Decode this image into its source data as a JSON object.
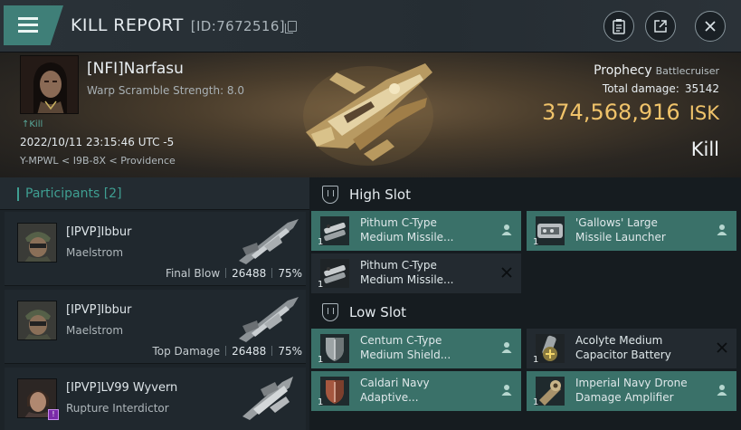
{
  "header": {
    "title": "KILL REPORT",
    "id_label": "[ID:7672516]"
  },
  "victim": {
    "name": "[NFI]Narfasu",
    "warp_scramble": "Warp Scramble Strength: 8.0",
    "kill_tag": "↑Kill",
    "timestamp": "2022/10/11 23:15:46 UTC -5",
    "location": "Y-MPWL < I9B-8X < Providence",
    "ship": "Prophecy",
    "ship_class": "Battlecruiser",
    "total_damage_label": "Total damage:",
    "total_damage": "35142",
    "isk_value": "374,568,916",
    "isk_unit": "ISK",
    "result": "Kill"
  },
  "participants": {
    "label": "Participants",
    "count": "[2]",
    "rows": [
      {
        "name": "[IPVP]Ibbur",
        "ship": "Maelstrom",
        "role": "Final Blow",
        "damage": "26488",
        "percent": "75%"
      },
      {
        "name": "[IPVP]Ibbur",
        "ship": "Maelstrom",
        "role": "Top Damage",
        "damage": "26488",
        "percent": "75%"
      },
      {
        "name": "[IPVP]LV99 Wyvern",
        "ship": "Rupture Interdictor",
        "role": "",
        "damage": "",
        "percent": ""
      }
    ]
  },
  "slots": {
    "high": {
      "label": "High Slot",
      "modules": [
        {
          "line1": "Pithum C-Type",
          "line2": "Medium Missile...",
          "qty": "1",
          "status": "fitted"
        },
        {
          "line1": "'Gallows' Large",
          "line2": "Missile Launcher",
          "qty": "1",
          "status": "fitted"
        },
        {
          "line1": "Pithum C-Type",
          "line2": "Medium Missile...",
          "qty": "1",
          "status": "destroyed"
        }
      ]
    },
    "low": {
      "label": "Low Slot",
      "modules": [
        {
          "line1": "Centum C-Type",
          "line2": "Medium Shield...",
          "qty": "1",
          "status": "fitted"
        },
        {
          "line1": "Acolyte Medium",
          "line2": "Capacitor Battery",
          "qty": "1",
          "status": "destroyed"
        },
        {
          "line1": "Caldari Navy",
          "line2": "Adaptive...",
          "qty": "1",
          "status": "fitted"
        },
        {
          "line1": "Imperial Navy Drone",
          "line2": "Damage Amplifier",
          "qty": "1",
          "status": "fitted"
        }
      ]
    }
  },
  "colors": {
    "accent": "#3f9f92",
    "isk": "#f0c36a",
    "fitted_bg": "#3a7169",
    "destroyed_bg": "#232a30"
  }
}
